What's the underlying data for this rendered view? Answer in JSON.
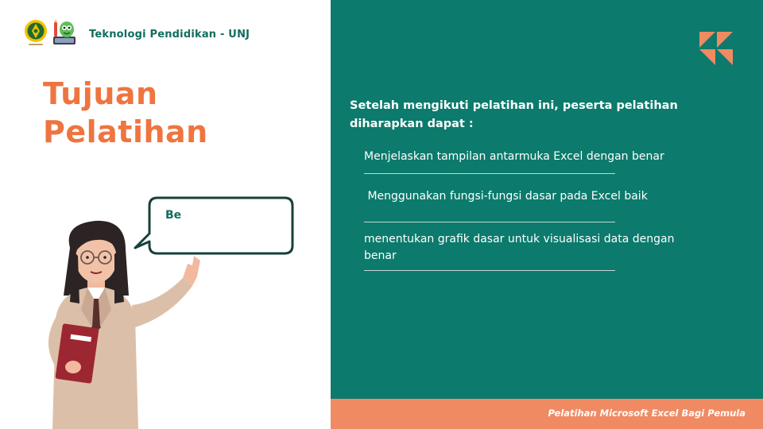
{
  "header": {
    "org_name": "Teknologi Pendidikan - UNJ",
    "logo_unj_icon": "unj-emblem-icon",
    "logo_mascot_icon": "mascot-logo-icon"
  },
  "title": {
    "line1": "Tujuan",
    "line2": "Pelatihan"
  },
  "speech_bubble": {
    "text": "Be"
  },
  "content": {
    "intro": "Setelah mengikuti pelatihan ini, peserta pelatihan diharapkan dapat :",
    "goals": [
      "Menjelaskan tampilan antarmuka Excel dengan benar",
      " Menggunakan fungsi-fungsi dasar pada Excel baik",
      "menentukan grafik dasar untuk visualisasi data dengan benar"
    ]
  },
  "footer": {
    "text": "Pelatihan Microsoft Excel Bagi Pemula"
  },
  "colors": {
    "teal": "#0c7a6c",
    "orange": "#ee7540",
    "footer_orange": "#f08a62",
    "dark_teal_text": "#116d5f"
  }
}
